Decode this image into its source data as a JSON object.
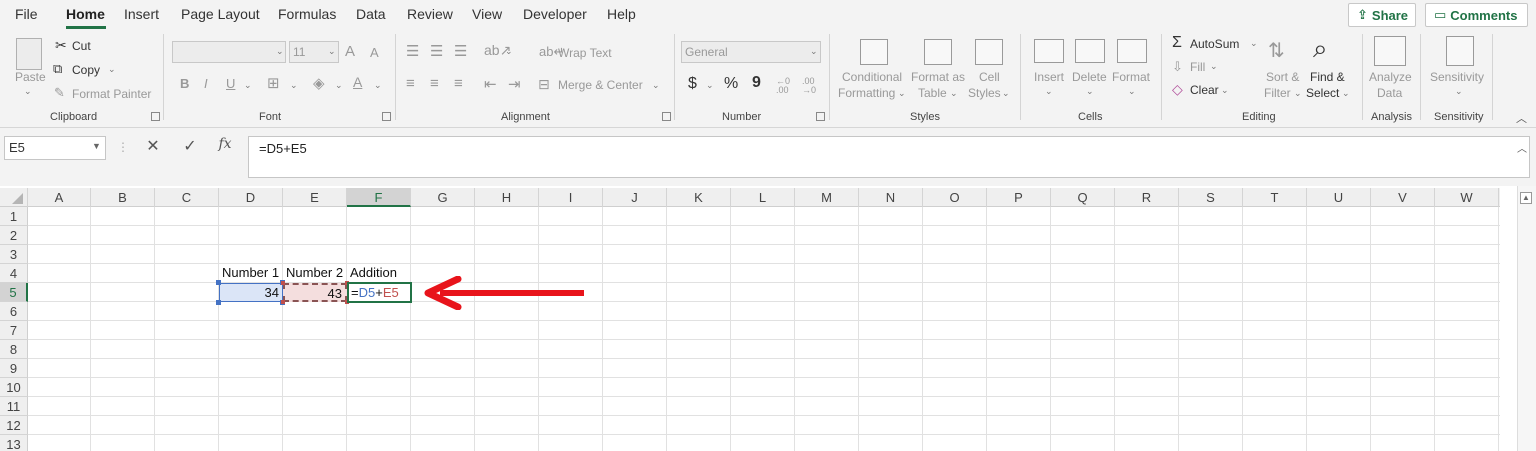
{
  "menu": {
    "items": [
      "File",
      "Home",
      "Insert",
      "Page Layout",
      "Formulas",
      "Data",
      "Review",
      "View",
      "Developer",
      "Help"
    ],
    "active": "Home",
    "share_label": "Share",
    "comments_label": "Comments"
  },
  "ribbon": {
    "clipboard": {
      "paste": "Paste",
      "cut": "Cut",
      "copy": "Copy",
      "format_painter": "Format Painter",
      "label": "Clipboard"
    },
    "font": {
      "font_size": "11",
      "label": "Font",
      "bold": "B",
      "italic": "I",
      "underline": "U",
      "grow": "A",
      "shrink": "A",
      "font_color": "A"
    },
    "alignment": {
      "wrap_text": "Wrap Text",
      "merge_center": "Merge & Center",
      "label": "Alignment"
    },
    "number": {
      "format": "General",
      "currency": "$",
      "percent": "%",
      "comma": "9",
      "increase_decimal": "←0 .00",
      "decrease_decimal": ".00 →0",
      "label": "Number"
    },
    "styles": {
      "conditional_1": "Conditional",
      "conditional_2": "Formatting",
      "format_table_1": "Format as",
      "format_table_2": "Table",
      "cell_styles_1": "Cell",
      "cell_styles_2": "Styles",
      "label": "Styles"
    },
    "cells": {
      "insert": "Insert",
      "delete": "Delete",
      "format": "Format",
      "label": "Cells"
    },
    "editing": {
      "autosum": "AutoSum",
      "fill": "Fill",
      "clear": "Clear",
      "sort_1": "Sort &",
      "sort_2": "Filter",
      "find_1": "Find &",
      "find_2": "Select",
      "label": "Editing"
    },
    "analysis": {
      "analyze_1": "Analyze",
      "analyze_2": "Data",
      "label": "Analysis"
    },
    "sensitivity": {
      "button": "Sensitivity",
      "label": "Sensitivity"
    }
  },
  "formula_bar": {
    "name_box": "E5",
    "fx": "fx",
    "formula": "=D5+E5"
  },
  "grid": {
    "columns": [
      "A",
      "B",
      "C",
      "D",
      "E",
      "F",
      "G",
      "H",
      "I",
      "J",
      "K",
      "L",
      "M",
      "N",
      "O",
      "P",
      "Q",
      "R",
      "S",
      "T",
      "U",
      "V",
      "W"
    ],
    "rows": [
      "1",
      "2",
      "3",
      "4",
      "5",
      "6",
      "7",
      "8",
      "9",
      "10",
      "11",
      "12",
      "13"
    ],
    "cells": {
      "D4": "Number 1",
      "E4": "Number 2",
      "F4": "Addition",
      "D5": "34",
      "E5": "43",
      "F5_eq": "=",
      "F5_ref1": "D5",
      "F5_plus": "+",
      "F5_ref2": "E5"
    }
  },
  "colors": {
    "accent": "#217346",
    "ref_blue": "#4472c4",
    "ref_red": "#c0504d",
    "arrow": "#e8141b"
  }
}
